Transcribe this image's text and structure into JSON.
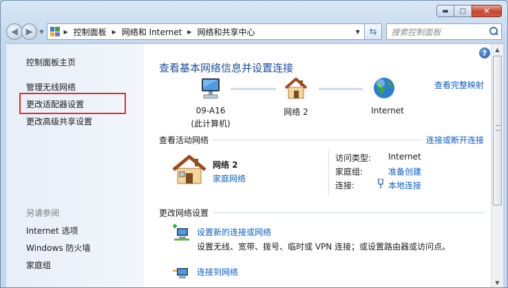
{
  "window": {
    "caption_buttons": [
      "minimize",
      "maximize",
      "close"
    ]
  },
  "navigation": {
    "back_icon": "back-arrow-icon",
    "forward_icon": "forward-arrow-icon",
    "breadcrumbs": [
      "控制面板",
      "网络和 Internet",
      "网络和共享中心"
    ],
    "search_placeholder": "搜索控制面板"
  },
  "sidebar": {
    "items": [
      {
        "label": "控制面板主页"
      },
      {
        "label": "管理无线网络"
      },
      {
        "label": "更改适配器设置",
        "highlighted": true
      },
      {
        "label": "更改高级共享设置"
      }
    ],
    "see_also_title": "另请参阅",
    "see_also": [
      {
        "label": "Internet 选项"
      },
      {
        "label": "Windows 防火墙"
      },
      {
        "label": "家庭组"
      }
    ]
  },
  "main": {
    "title": "查看基本网络信息并设置连接",
    "view_full_map": "查看完整映射",
    "map_nodes": [
      {
        "label": "09-A16",
        "sublabel": "(此计算机)",
        "icon": "computer-icon"
      },
      {
        "label": "网络  2",
        "icon": "house-icon"
      },
      {
        "label": "Internet",
        "icon": "globe-icon"
      }
    ],
    "active_networks_title": "查看活动网络",
    "connect_disconnect": "连接或断开连接",
    "active_network": {
      "name": "网络  2",
      "type": "家庭网络",
      "props": [
        {
          "label": "访问类型:",
          "value": "Internet",
          "is_link": false
        },
        {
          "label": "家庭组:",
          "value": "准备创建",
          "is_link": true
        },
        {
          "label": "连接:",
          "value": "本地连接",
          "is_link": true
        }
      ]
    },
    "change_settings_title": "更改网络设置",
    "tasks": [
      {
        "title": "设置新的连接或网络",
        "desc": "设置无线、宽带、拨号、临时或 VPN 连接；或设置路由器或访问点。"
      },
      {
        "title": "连接到网络",
        "desc": ""
      }
    ]
  }
}
